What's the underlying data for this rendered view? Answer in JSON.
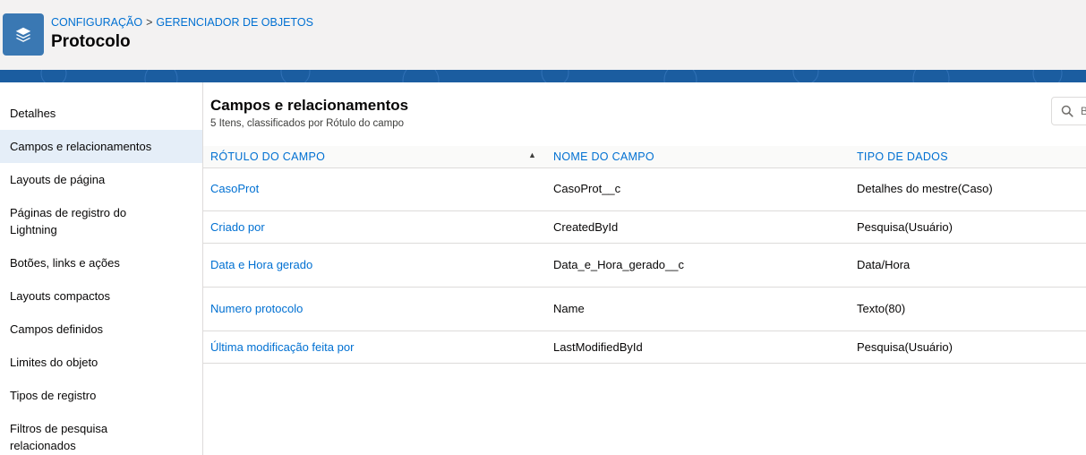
{
  "header": {
    "breadcrumb": [
      "CONFIGURAÇÃO",
      "GERENCIADOR DE OBJETOS"
    ],
    "breadcrumb_separator": ">",
    "title": "Protocolo",
    "icon": "layers-icon",
    "icon_color": "#3a78b3"
  },
  "sidebar": {
    "items": [
      {
        "label": "Detalhes",
        "active": false
      },
      {
        "label": "Campos e relacionamentos",
        "active": true
      },
      {
        "label": "Layouts de página",
        "active": false
      },
      {
        "label": "Páginas de registro do Lightning",
        "active": false
      },
      {
        "label": "Botões, links e ações",
        "active": false
      },
      {
        "label": "Layouts compactos",
        "active": false
      },
      {
        "label": "Campos definidos",
        "active": false
      },
      {
        "label": "Limites do objeto",
        "active": false
      },
      {
        "label": "Tipos de registro",
        "active": false
      },
      {
        "label": "Filtros de pesquisa relacionados",
        "active": false
      }
    ]
  },
  "main": {
    "title": "Campos e relacionamentos",
    "subtitle": "5 Itens, classificados por Rótulo do campo",
    "search_placeholder": "B",
    "columns": [
      "RÓTULO DO CAMPO",
      "NOME DO CAMPO",
      "TIPO DE DADOS"
    ],
    "sort_indicator": "▲",
    "rows": [
      {
        "label": "CasoProt",
        "name": "CasoProt__c",
        "type": "Detalhes do mestre(Caso)"
      },
      {
        "label": "Criado por",
        "name": "CreatedById",
        "type": "Pesquisa(Usuário)"
      },
      {
        "label": "Data e Hora gerado",
        "name": "Data_e_Hora_gerado__c",
        "type": "Data/Hora"
      },
      {
        "label": "Numero protocolo",
        "name": "Name",
        "type": "Texto(80)"
      },
      {
        "label": "Última modificação feita por",
        "name": "LastModifiedById",
        "type": "Pesquisa(Usuário)"
      }
    ]
  },
  "colors": {
    "link": "#0070d2",
    "brand_band": "#1b5da0",
    "active_item_bg": "#e5eef8"
  }
}
